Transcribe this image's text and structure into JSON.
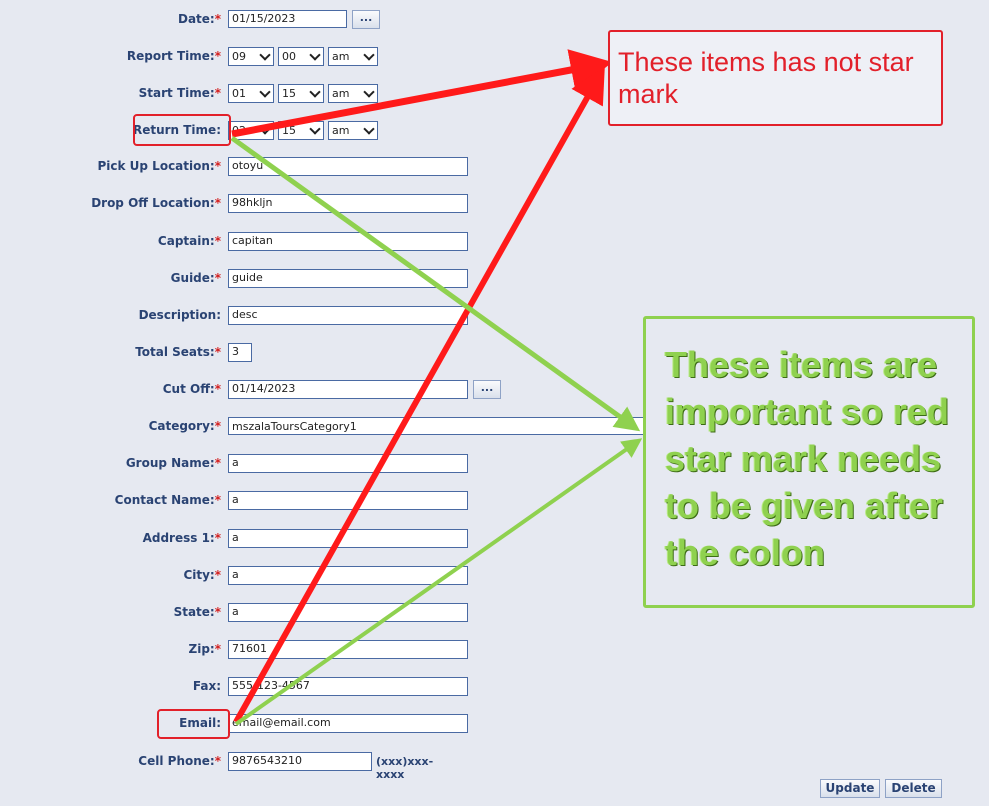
{
  "form": {
    "date": {
      "label": "Date:",
      "star": "*",
      "value": "01/15/2023",
      "picker": "..."
    },
    "report_time": {
      "label": "Report Time:",
      "star": "*",
      "hour": "09",
      "minute": "00",
      "ampm": "am"
    },
    "start_time": {
      "label": "Start Time:",
      "star": "*",
      "hour": "01",
      "minute": "15",
      "ampm": "am"
    },
    "return_time": {
      "label": "Return Time:",
      "star": "",
      "hour": "02",
      "minute": "15",
      "ampm": "am"
    },
    "pickup_location": {
      "label": "Pick Up Location:",
      "star": "*",
      "value": "otoyu"
    },
    "dropoff_location": {
      "label": "Drop Off Location:",
      "star": "*",
      "value": "98hkljn"
    },
    "captain": {
      "label": "Captain:",
      "star": "*",
      "value": "capitan"
    },
    "guide": {
      "label": "Guide:",
      "star": "*",
      "value": "guide"
    },
    "description": {
      "label": "Description:",
      "star": "",
      "value": "desc"
    },
    "total_seats": {
      "label": "Total Seats:",
      "star": "*",
      "value": "3"
    },
    "cut_off": {
      "label": "Cut Off:",
      "star": "*",
      "value": "01/14/2023",
      "picker": "..."
    },
    "category": {
      "label": "Category:",
      "star": "*",
      "value": "mszalaToursCategory1"
    },
    "group_name": {
      "label": "Group Name:",
      "star": "*",
      "value": "a"
    },
    "contact_name": {
      "label": "Contact Name:",
      "star": "*",
      "value": "a"
    },
    "address1": {
      "label": "Address 1:",
      "star": "*",
      "value": "a"
    },
    "city": {
      "label": "City:",
      "star": "*",
      "value": "a"
    },
    "state": {
      "label": "State:",
      "star": "*",
      "value": "a"
    },
    "zip": {
      "label": "Zip:",
      "star": "*",
      "value": "71601"
    },
    "fax": {
      "label": "Fax:",
      "star": "",
      "value": "555-123-4567"
    },
    "email": {
      "label": "Email:",
      "star": "",
      "value": "email@email.com"
    },
    "cell_phone": {
      "label": "Cell Phone:",
      "star": "*",
      "value": "9876543210",
      "hint": "(xxx)xxx-xxxx"
    }
  },
  "actions": {
    "update": "Update",
    "delete": "Delete"
  },
  "annotations": {
    "red_note": "These items has not star mark",
    "green_note": "These items are important so red star mark needs to be given after the colon"
  },
  "colors": {
    "required_star": "#d42020",
    "annotation_red": "#e2202a",
    "annotation_green": "#8fd14f",
    "background": "#e6e9f1"
  }
}
